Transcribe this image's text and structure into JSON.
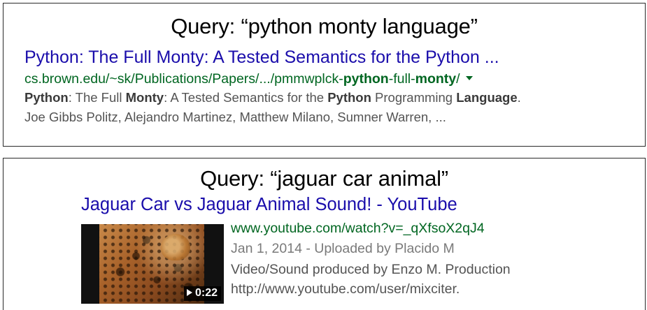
{
  "results": [
    {
      "query_label": "Query: “python monty language”",
      "title": "Python: The Full Monty: A Tested Semantics for the Python ...",
      "url_prefix": "cs.brown.edu/~sk/Publications/Papers/.../pmmwplck-",
      "url_bold_1": "python",
      "url_mid": "-full-",
      "url_bold_2": "monty",
      "url_suffix": "/",
      "snippet_line1": {
        "p1": "Python",
        "p2": ": The Full ",
        "p3": "Monty",
        "p4": ": A Tested Semantics for the ",
        "p5": "Python",
        "p6": " Programming ",
        "p7": "Language",
        "p8": "."
      },
      "snippet_line2": "Joe Gibbs Politz, Alejandro Martinez, Matthew Milano, Sumner Warren, ..."
    },
    {
      "query_label": "Query: “jaguar car animal”",
      "title": "Jaguar Car vs Jaguar Animal Sound! - YouTube",
      "url": "www.youtube.com/watch?v=_qXfsoX2qJ4",
      "meta": "Jan 1, 2014 - Uploaded by Placido M",
      "desc_line1": "Video/Sound produced by Enzo M. Production",
      "desc_line2": "http://www.youtube.com/user/mixciter.",
      "duration": "0:22"
    }
  ],
  "colors": {
    "title_link": "#1a0dab",
    "url_green": "#006621",
    "snippet_gray": "#545454"
  },
  "icons": {
    "url_menu": "caret-down-icon",
    "play": "play-icon"
  }
}
